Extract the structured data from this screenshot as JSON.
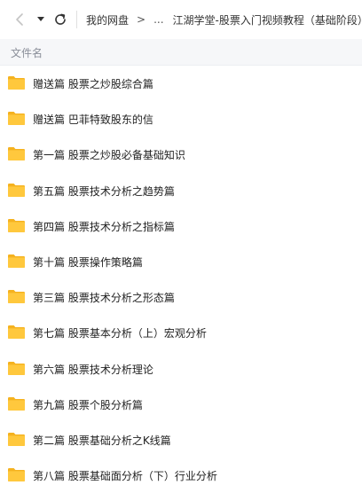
{
  "breadcrumb": {
    "root": "我的网盘",
    "separator": ">",
    "ellipsis": "...",
    "current": "江湖学堂-股票入门视频教程（基础阶段）"
  },
  "list_header": {
    "name_column": "文件名"
  },
  "colors": {
    "folder": "#ffc83d",
    "folder_dark": "#f5b21f",
    "header_bg": "#f6f7f9"
  },
  "files": [
    {
      "name": "赠送篇 股票之炒股综合篇",
      "icon": "folder-icon"
    },
    {
      "name": "赠送篇 巴菲特致股东的信",
      "icon": "folder-icon"
    },
    {
      "name": "第一篇 股票之炒股必备基础知识",
      "icon": "folder-icon"
    },
    {
      "name": "第五篇 股票技术分析之趋势篇",
      "icon": "folder-icon"
    },
    {
      "name": "第四篇 股票技术分析之指标篇",
      "icon": "folder-icon"
    },
    {
      "name": "第十篇 股票操作策略篇",
      "icon": "folder-icon"
    },
    {
      "name": "第三篇 股票技术分析之形态篇",
      "icon": "folder-icon"
    },
    {
      "name": "第七篇 股票基本分析（上）宏观分析",
      "icon": "folder-icon"
    },
    {
      "name": "第六篇 股票技术分析理论",
      "icon": "folder-icon"
    },
    {
      "name": "第九篇 股票个股分析篇",
      "icon": "folder-icon"
    },
    {
      "name": "第二篇 股票基础分析之K线篇",
      "icon": "folder-icon"
    },
    {
      "name": "第八篇 股票基础面分析（下）行业分析",
      "icon": "folder-icon"
    }
  ]
}
